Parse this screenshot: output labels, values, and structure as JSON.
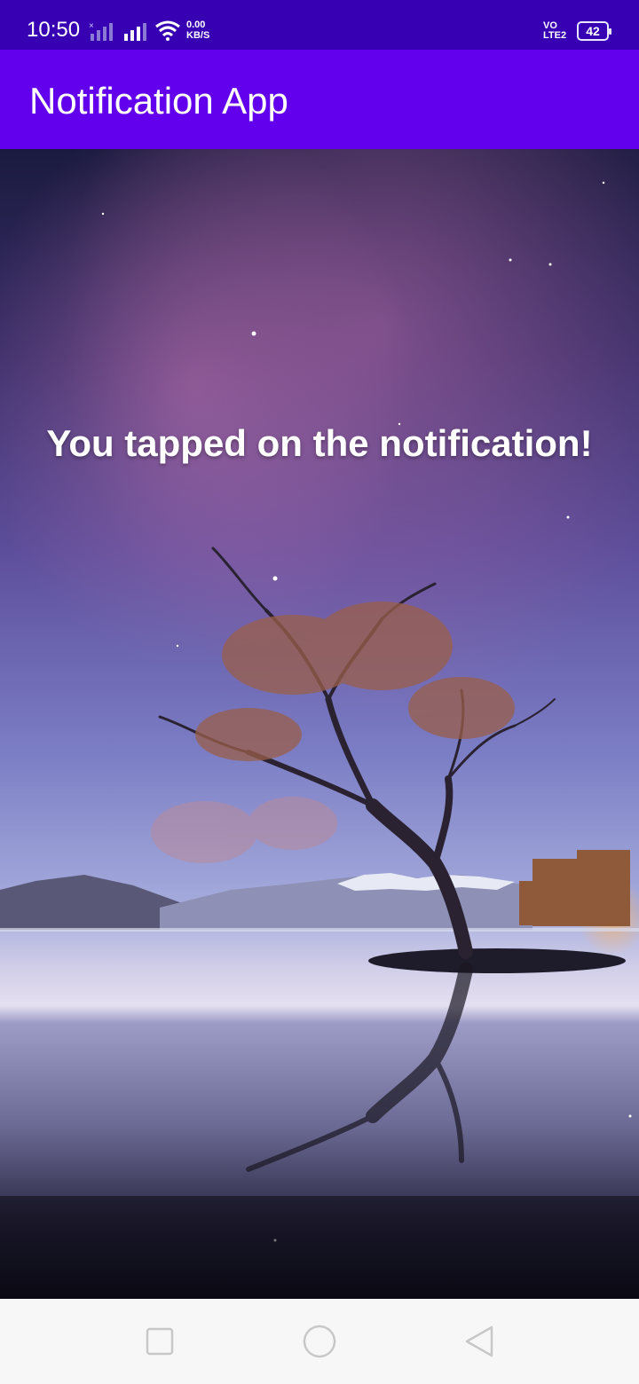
{
  "status_bar": {
    "time": "10:50",
    "network_speed": "0.00",
    "network_speed_unit": "KB/S",
    "volte_label": "VO",
    "lte_label": "LTE2",
    "battery_level": "42"
  },
  "app_bar": {
    "title": "Notification App"
  },
  "main": {
    "message": "You tapped on the notification!",
    "background_image": "lone-tree-lake-night-sky"
  },
  "nav_bar": {
    "icons": [
      "recents-square-icon",
      "home-circle-icon",
      "back-triangle-icon"
    ]
  },
  "colors": {
    "status_bar": "#3700b3",
    "app_bar": "#6200ee",
    "nav_bar": "#f7f7f7"
  }
}
